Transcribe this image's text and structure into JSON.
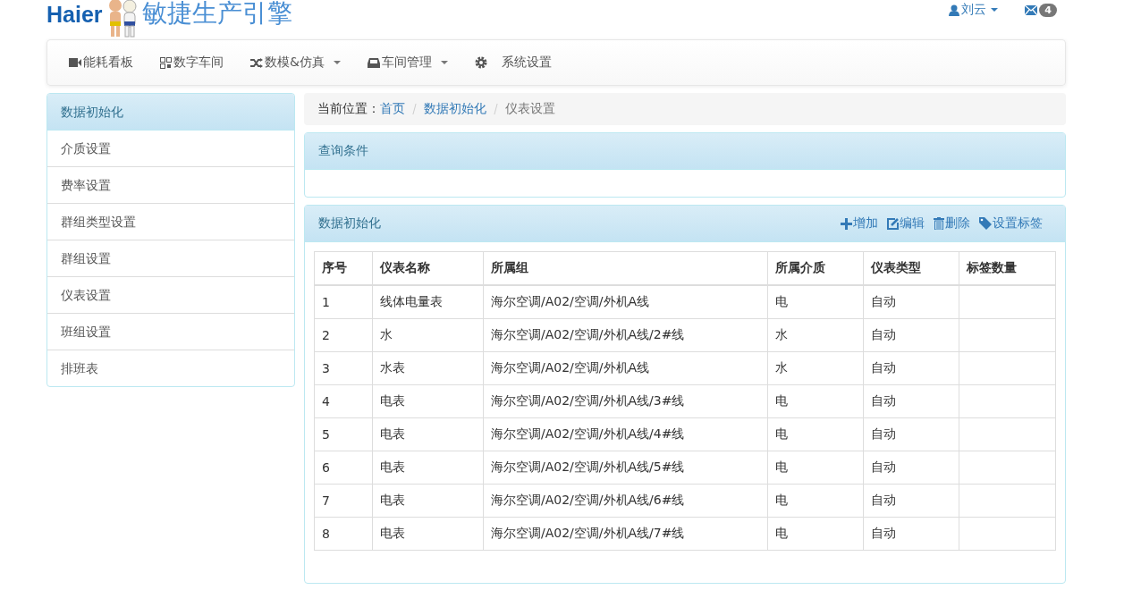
{
  "header": {
    "logo_text": "Haier",
    "title": "敏捷生产引擎",
    "user": "刘云",
    "messages_count": "4"
  },
  "nav": [
    {
      "label": "能耗看板",
      "kind": "video",
      "dropdown": false
    },
    {
      "label": "数字车间",
      "kind": "qrcode",
      "dropdown": false
    },
    {
      "label": "数模&仿真",
      "kind": "random",
      "dropdown": true
    },
    {
      "label": "车间管理",
      "kind": "inbox",
      "dropdown": true
    },
    {
      "label": "系统设置",
      "kind": "cog",
      "dropdown": false
    }
  ],
  "sidebar": {
    "title": "数据初始化",
    "items": [
      "介质设置",
      "费率设置",
      "群组类型设置",
      "群组设置",
      "仪表设置",
      "班组设置",
      "排班表"
    ]
  },
  "breadcrumb": {
    "prefix": "当前位置：",
    "links": [
      "首页",
      "数据初始化"
    ],
    "current": "仪表设置"
  },
  "query_panel": {
    "title": "查询条件"
  },
  "data_panel": {
    "title": "数据初始化",
    "actions": [
      {
        "label": "增加",
        "kind": "plus"
      },
      {
        "label": "编辑",
        "kind": "edit"
      },
      {
        "label": "删除",
        "kind": "trash"
      },
      {
        "label": "设置标签",
        "kind": "tag"
      }
    ]
  },
  "table": {
    "columns": [
      "序号",
      "仪表名称",
      "所属组",
      "所属介质",
      "仪表类型",
      "标签数量"
    ],
    "rows": [
      [
        "1",
        "线体电量表",
        "海尔空调/A02/空调/外机A线",
        "电",
        "自动",
        ""
      ],
      [
        "2",
        "水",
        "海尔空调/A02/空调/外机A线/2#线",
        "水",
        "自动",
        ""
      ],
      [
        "3",
        "水表",
        "海尔空调/A02/空调/外机A线",
        "水",
        "自动",
        ""
      ],
      [
        "4",
        "电表",
        "海尔空调/A02/空调/外机A线/3#线",
        "电",
        "自动",
        ""
      ],
      [
        "5",
        "电表",
        "海尔空调/A02/空调/外机A线/4#线",
        "电",
        "自动",
        ""
      ],
      [
        "6",
        "电表",
        "海尔空调/A02/空调/外机A线/5#线",
        "电",
        "自动",
        ""
      ],
      [
        "7",
        "电表",
        "海尔空调/A02/空调/外机A线/6#线",
        "电",
        "自动",
        ""
      ],
      [
        "8",
        "电表",
        "海尔空调/A02/空调/外机A线/7#线",
        "电",
        "自动",
        ""
      ]
    ]
  }
}
